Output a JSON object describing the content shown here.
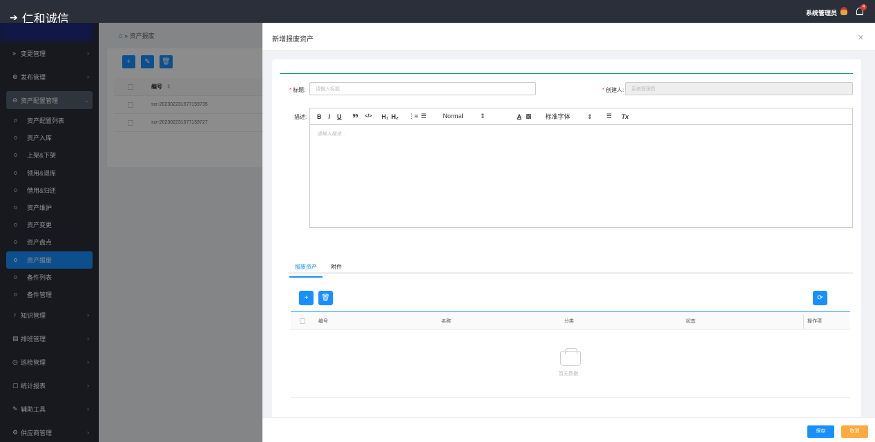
{
  "app": {
    "logo_text": "仁和诚信",
    "user_name": "系统管理员",
    "notification_count": "4"
  },
  "sidebar": {
    "menus": [
      {
        "label": "变更管理",
        "icon": "»"
      },
      {
        "label": "发布管理",
        "icon": "⊕"
      },
      {
        "label": "资产配置管理",
        "icon": "⊖"
      }
    ],
    "submenu": [
      "资产配置列表",
      "资产入库",
      "上架&下架",
      "领用&退库",
      "借用&归还",
      "资产维护",
      "资产变更",
      "资产盘点",
      "资产报废",
      "备件列表",
      "备件管理"
    ],
    "active_sub": "资产报废",
    "menus_after": [
      {
        "label": "知识管理",
        "icon": "♀"
      },
      {
        "label": "排班管理",
        "icon": "▤"
      },
      {
        "label": "巡检管理",
        "icon": "◷"
      },
      {
        "label": "统计报表",
        "icon": "▢"
      },
      {
        "label": "辅助工具",
        "icon": "✎"
      },
      {
        "label": "供应商管理",
        "icon": "⚙"
      }
    ]
  },
  "breadcrumb": {
    "current": "资产报废"
  },
  "background_table": {
    "col_number": "编号",
    "rows": [
      "scr-202302231677159735",
      "scr-202302231677159727"
    ]
  },
  "drawer": {
    "title": "新增报废资产",
    "title_label": "标题:",
    "title_placeholder": "请输入标题",
    "creator_label": "创建人:",
    "creator_value": "系统管理员",
    "desc_label": "描述:",
    "editor_toolbar": {
      "bold": "B",
      "italic": "I",
      "underline": "U",
      "quote": "99",
      "code": "</>",
      "h1": "H₁",
      "h2": "H₂",
      "ol": "⋮≡",
      "ul": "☰",
      "size": "Normal",
      "color": "A",
      "bg": "▩",
      "font": "标准字体",
      "align": "☰",
      "clear": "Tx"
    },
    "editor_placeholder": "请输入描述...",
    "tabs": [
      "报废资产",
      "附件"
    ],
    "grid_columns": [
      "编号",
      "名称",
      "分类",
      "状态",
      "操作项"
    ],
    "empty_text": "暂无数据",
    "save_label": "保存",
    "cancel_label": "取消"
  },
  "colors": {
    "primary": "#1890ff",
    "sidebar": "#2b2f3a",
    "cancel": "#ffa940",
    "divider": "#1a9a7a"
  }
}
